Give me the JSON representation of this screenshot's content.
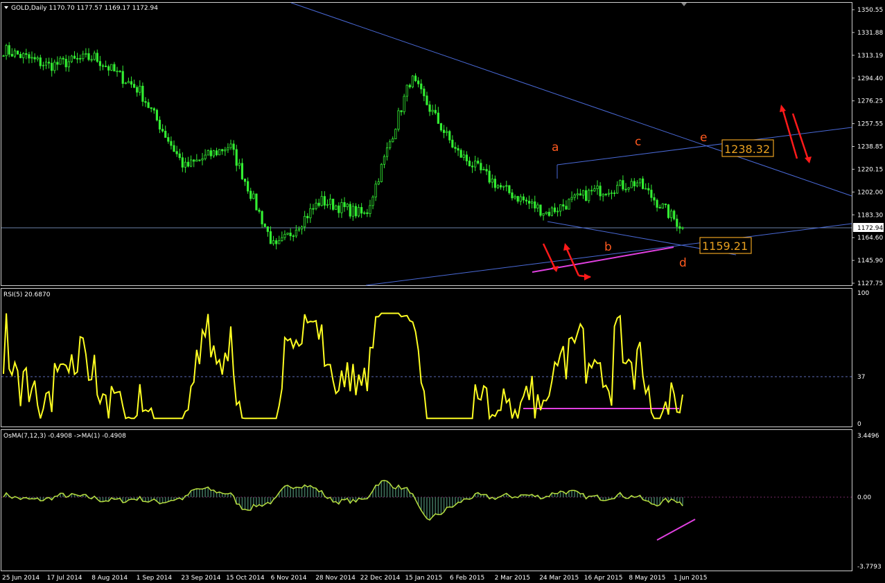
{
  "chart_header": {
    "symbol_line": "GOLD,Daily  1170.70 1177.57 1169.17 1172.94"
  },
  "price_axis": {
    "ticks": [
      "1350.55",
      "1331.88",
      "1313.19",
      "1294.40",
      "1276.25",
      "1257.55",
      "1238.85",
      "1220.15",
      "1202.00",
      "1183.30",
      "1164.60",
      "1145.90",
      "1127.75"
    ],
    "current_price": "1172.94"
  },
  "annotations": {
    "wave_labels": [
      "a",
      "b",
      "c",
      "d",
      "e"
    ],
    "upper_box": "1238.32",
    "lower_box": "1159.21"
  },
  "rsi": {
    "title": "RSI(5) 20.6870",
    "ticks": [
      "100",
      "37",
      "0"
    ]
  },
  "osma": {
    "title": "OsMA(7,12,3) -0.4908  ->MA(1) -0.4908",
    "ticks": [
      "3.4496",
      "0.00",
      "-3.7793"
    ]
  },
  "time_axis": {
    "ticks": [
      "25 Jun 2014",
      "17 Jul 2014",
      "8 Aug 2014",
      "1 Sep 2014",
      "23 Sep 2014",
      "15 Oct 2014",
      "6 Nov 2014",
      "28 Nov 2014",
      "22 Dec 2014",
      "15 Jan 2015",
      "6 Feb 2015",
      "2 Mar 2015",
      "24 Mar 2015",
      "16 Apr 2015",
      "8 May 2015",
      "1 Jun 2015"
    ]
  },
  "colors": {
    "background": "#000000",
    "grid": "#ffffff",
    "candles": "#33ee33",
    "trendlines": "#4a6ad8",
    "wave_labels": "#ff5a1f",
    "boxes": "#e8a020",
    "arrows": "#ff1a1a",
    "divergence": "#e040e0",
    "rsi_line": "#ffff22",
    "osma_bars": "#3d6e5a",
    "osma_line": "#b8e040"
  },
  "chart_data": [
    {
      "type": "candlestick",
      "title": "GOLD,Daily",
      "ylim": [
        1127.75,
        1350.55
      ],
      "x": [
        "25 Jun 2014",
        "17 Jul 2014",
        "8 Aug 2014",
        "1 Sep 2014",
        "23 Sep 2014",
        "15 Oct 2014",
        "6 Nov 2014",
        "28 Nov 2014",
        "22 Dec 2014",
        "15 Jan 2015",
        "6 Feb 2015",
        "2 Mar 2015",
        "24 Mar 2015",
        "16 Apr 2015",
        "8 May 2015",
        "1 Jun 2015"
      ],
      "approx_close": [
        1318,
        1305,
        1312,
        1285,
        1222,
        1240,
        1155,
        1195,
        1183,
        1295,
        1235,
        1205,
        1185,
        1202,
        1210,
        1173
      ],
      "last": {
        "open": 1170.7,
        "high": 1177.57,
        "low": 1169.17,
        "close": 1172.94
      }
    },
    {
      "type": "line",
      "title": "RSI(5) 20.6870",
      "ylim": [
        0,
        100
      ],
      "level": 37,
      "current": 20.687
    },
    {
      "type": "bar",
      "title": "OsMA(7,12,3) -0.4908  ->MA(1) -0.4908",
      "ylim": [
        -3.7793,
        3.4496
      ],
      "current": -0.4908
    }
  ]
}
